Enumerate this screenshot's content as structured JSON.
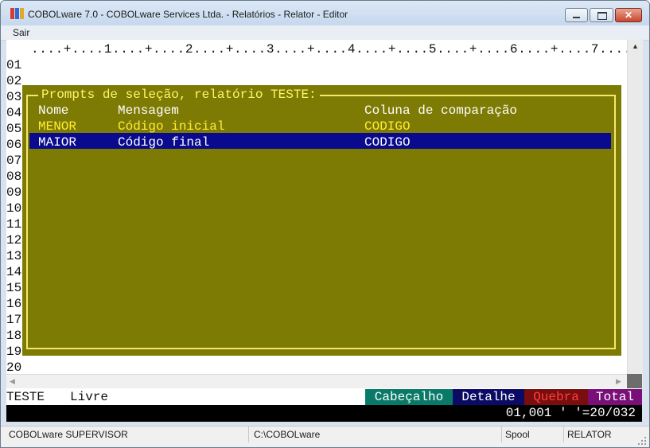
{
  "window": {
    "title": "COBOLware 7.0 - COBOLware Services Ltda. - Relatórios - Relator - Editor",
    "minimize_glyph": "",
    "close_glyph": "✕"
  },
  "menu": {
    "items": [
      "Sair"
    ]
  },
  "editor": {
    "ruler": "....+....1....+....2....+....3....+....4....+....5....+....6....+....7....+",
    "line_numbers": [
      "01",
      "02",
      "03",
      "04",
      "05",
      "06",
      "07",
      "08",
      "09",
      "10",
      "11",
      "12",
      "13",
      "14",
      "15",
      "16",
      "17",
      "18",
      "19",
      "20"
    ]
  },
  "dialog": {
    "title": "Prompts de seleção, relatório TESTE:",
    "columns": [
      "Nome",
      "Mensagem",
      "Coluna de comparação"
    ],
    "rows": [
      {
        "name": "MENOR",
        "message": "Código inicial",
        "column": "CODIGO",
        "selected": false
      },
      {
        "name": "MAIOR",
        "message": "Código final",
        "column": "CODIGO",
        "selected": true
      }
    ]
  },
  "status": {
    "report": "TESTE",
    "mode": "Livre",
    "tabs": [
      {
        "label": "Cabeçalho",
        "bg": "#0a7a68",
        "fg": "#ffffff"
      },
      {
        "label": "Detalhe",
        "bg": "#0b0b66",
        "fg": "#ffffff"
      },
      {
        "label": "Quebra",
        "bg": "#7a0d0d",
        "fg": "#ff4040"
      },
      {
        "label": "Total",
        "bg": "#7a0f7a",
        "fg": "#ffffff"
      }
    ],
    "position": "01,001 ' '=20/032"
  },
  "bottom": {
    "user": "COBOLware SUPERVISOR",
    "path": "C:\\COBOLware",
    "spool": "Spool",
    "program": "RELATOR"
  },
  "colors": {
    "dialog_bg": "#7e7b05",
    "selection": "#0a0a8e",
    "text_yellow": "#ffee33"
  }
}
